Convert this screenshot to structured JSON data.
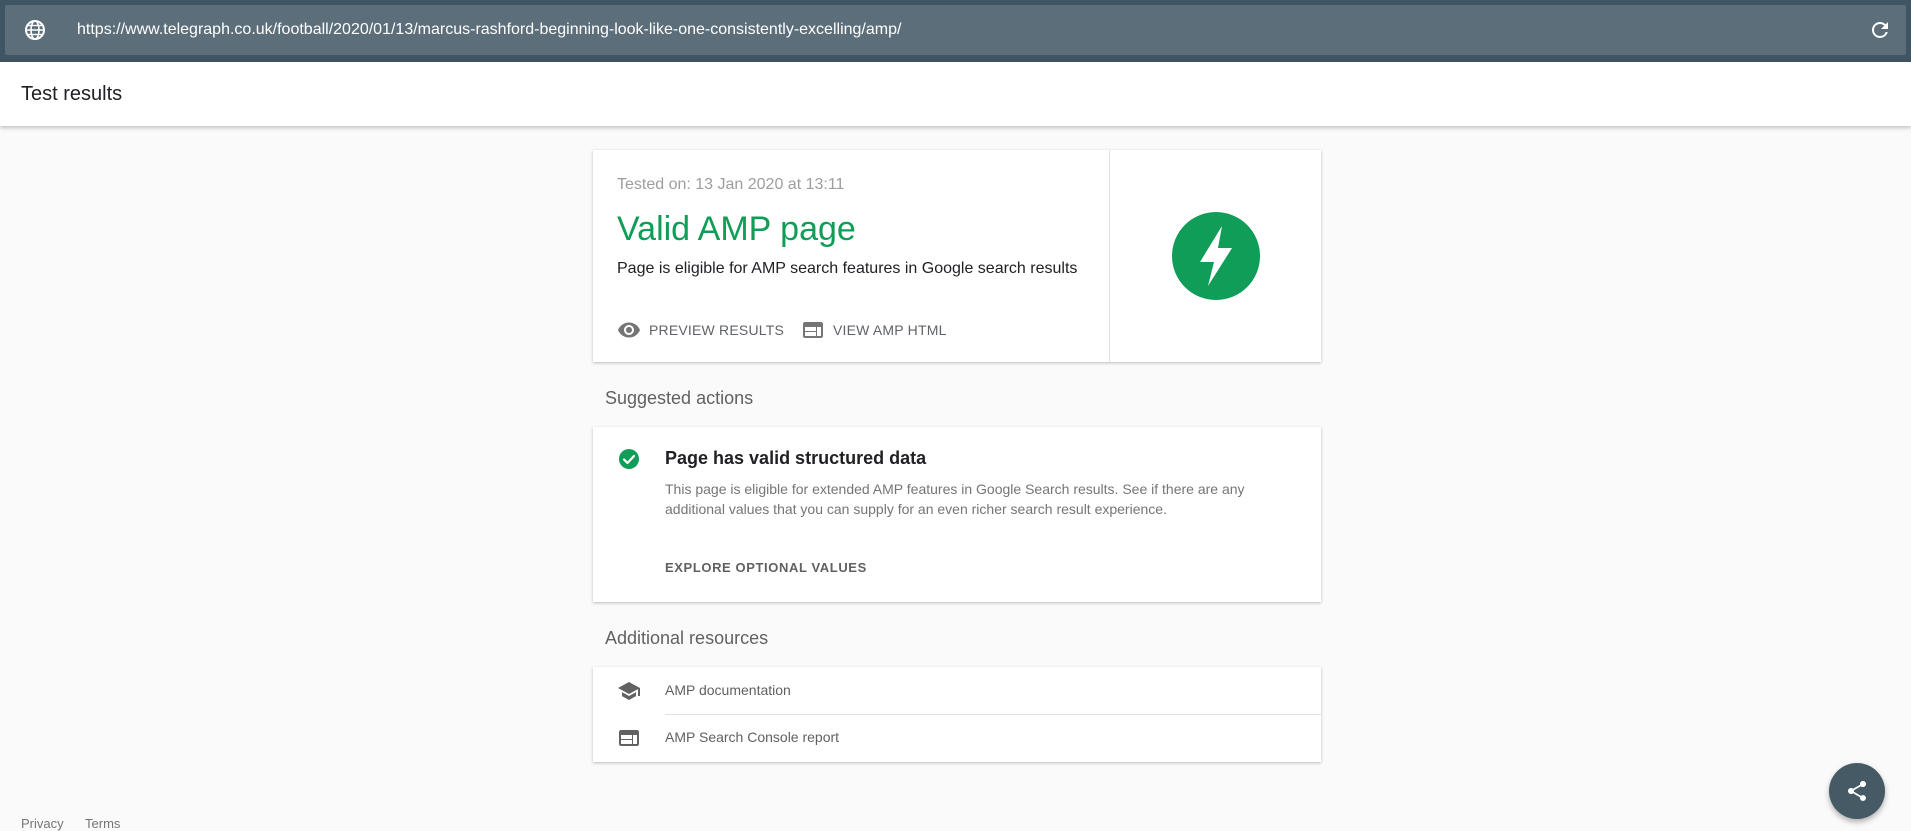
{
  "urlbar": {
    "url": "https://www.telegraph.co.uk/football/2020/01/13/marcus-rashford-beginning-look-like-one-consistently-excelling/amp/",
    "left_icon": "globe-icon",
    "right_icon": "reload-icon"
  },
  "header": {
    "title": "Test results"
  },
  "result": {
    "tested_on": "Tested on: 13 Jan 2020 at 13:11",
    "title": "Valid AMP page",
    "description": "Page is eligible for AMP search features in Google search results",
    "actions": {
      "preview": "PREVIEW RESULTS",
      "view_html": "VIEW AMP HTML"
    },
    "logo_icon": "amp-bolt-icon"
  },
  "suggested": {
    "section_title": "Suggested actions",
    "item_title": "Page has valid structured data",
    "item_desc": "This page is eligible for extended AMP features in Google Search results. See if there are any additional values that you can supply for an even richer search result experience.",
    "action": "EXPLORE OPTIONAL VALUES"
  },
  "additional": {
    "section_title": "Additional resources",
    "items": [
      {
        "label": "AMP documentation",
        "icon": "school-icon"
      },
      {
        "label": "AMP Search Console report",
        "icon": "web-icon"
      }
    ]
  },
  "footer": {
    "privacy": "Privacy",
    "terms": "Terms"
  },
  "colors": {
    "accent_green": "#0f9d58",
    "urlbar_bg": "#5b6e7a",
    "fab_bg": "#455a64"
  }
}
